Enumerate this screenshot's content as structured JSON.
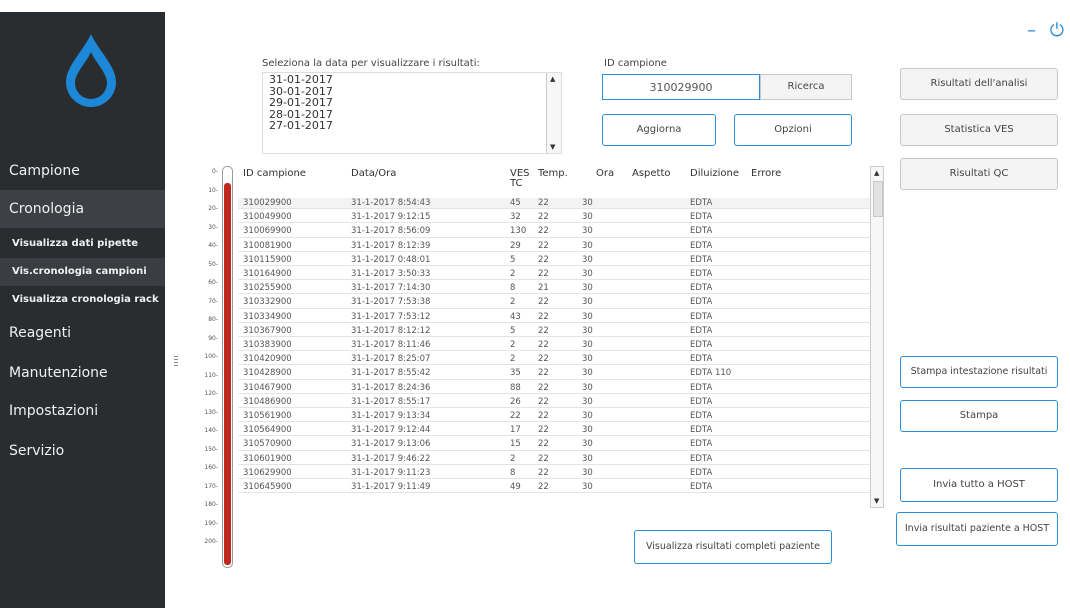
{
  "sidebar": {
    "items": [
      {
        "label": "Campione"
      },
      {
        "label": "Cronologia"
      },
      {
        "label": "Visualizza dati pipette"
      },
      {
        "label": "Vis.cronologia campioni"
      },
      {
        "label": "Visualizza cronologia rack"
      },
      {
        "label": "Reagenti"
      },
      {
        "label": "Manutenzione"
      },
      {
        "label": "Impostazioni"
      },
      {
        "label": "Servizio"
      }
    ]
  },
  "window": {
    "minimize": "–",
    "power": "⏻"
  },
  "date_selector": {
    "label": "Seleziona la data per visualizzare i risultati:",
    "dates": [
      "31-01-2017",
      "30-01-2017",
      "29-01-2017",
      "28-01-2017",
      "27-01-2017"
    ]
  },
  "search": {
    "label": "ID campione",
    "value": "310029900",
    "button": "Ricerca"
  },
  "actions": {
    "aggiorna": "Aggiorna",
    "opzioni": "Opzioni"
  },
  "right_buttons": {
    "risultati_analisi": "Risultati dell'analisi",
    "statistica_ves": "Statistica VES",
    "risultati_qc": "Risultati QC",
    "stampa_intestazione": "Stampa intestazione risultati",
    "stampa": "Stampa",
    "invia_tutto": "Invia tutto a HOST",
    "invia_paziente": "Invia risultati paziente a HOST"
  },
  "bottom_button": "Visualizza risultati completi paziente",
  "thermometer_ticks": [
    "0-",
    "10-",
    "20-",
    "30-",
    "40-",
    "50-",
    "60-",
    "70-",
    "80-",
    "90-",
    "100-",
    "110-",
    "120-",
    "130-",
    "140-",
    "150-",
    "160-",
    "170-",
    "180-",
    "190-",
    "200-"
  ],
  "table": {
    "headers": [
      "ID campione",
      "Data/Ora",
      "VES TC",
      "Temp.",
      "Ora",
      "Aspetto",
      "Diluizione",
      "Errore"
    ],
    "rows": [
      [
        "310029900",
        "31-1-2017 8:54:43",
        "45",
        "22",
        "30",
        "",
        "EDTA",
        ""
      ],
      [
        "310049900",
        "31-1-2017 9:12:15",
        "32",
        "22",
        "30",
        "",
        "EDTA",
        ""
      ],
      [
        "310069900",
        "31-1-2017 8:56:09",
        "130",
        "22",
        "30",
        "",
        "EDTA",
        ""
      ],
      [
        "310081900",
        "31-1-2017 8:12:39",
        "29",
        "22",
        "30",
        "",
        "EDTA",
        ""
      ],
      [
        "310115900",
        "31-1-2017 0:48:01",
        "5",
        "22",
        "30",
        "",
        "EDTA",
        ""
      ],
      [
        "310164900",
        "31-1-2017 3:50:33",
        "2",
        "22",
        "30",
        "",
        "EDTA",
        ""
      ],
      [
        "310255900",
        "31-1-2017 7:14:30",
        "8",
        "21",
        "30",
        "",
        "EDTA",
        ""
      ],
      [
        "310332900",
        "31-1-2017 7:53:38",
        "2",
        "22",
        "30",
        "",
        "EDTA",
        ""
      ],
      [
        "310334900",
        "31-1-2017 7:53:12",
        "43",
        "22",
        "30",
        "",
        "EDTA",
        ""
      ],
      [
        "310367900",
        "31-1-2017 8:12:12",
        "5",
        "22",
        "30",
        "",
        "EDTA",
        ""
      ],
      [
        "310383900",
        "31-1-2017 8:11:46",
        "2",
        "22",
        "30",
        "",
        "EDTA",
        ""
      ],
      [
        "310420900",
        "31-1-2017 8:25:07",
        "2",
        "22",
        "30",
        "",
        "EDTA",
        ""
      ],
      [
        "310428900",
        "31-1-2017 8:55:42",
        "35",
        "22",
        "30",
        "",
        "EDTA 110",
        ""
      ],
      [
        "310467900",
        "31-1-2017 8:24:36",
        "88",
        "22",
        "30",
        "",
        "EDTA",
        ""
      ],
      [
        "310486900",
        "31-1-2017 8:55:17",
        "26",
        "22",
        "30",
        "",
        "EDTA",
        ""
      ],
      [
        "310561900",
        "31-1-2017 9:13:34",
        "22",
        "22",
        "30",
        "",
        "EDTA",
        ""
      ],
      [
        "310564900",
        "31-1-2017 9:12:44",
        "17",
        "22",
        "30",
        "",
        "EDTA",
        ""
      ],
      [
        "310570900",
        "31-1-2017 9:13:06",
        "15",
        "22",
        "30",
        "",
        "EDTA",
        ""
      ],
      [
        "310601900",
        "31-1-2017 9:46:22",
        "2",
        "22",
        "30",
        "",
        "EDTA",
        ""
      ],
      [
        "310629900",
        "31-1-2017 9:11:23",
        "8",
        "22",
        "30",
        "",
        "EDTA",
        ""
      ],
      [
        "310645900",
        "31-1-2017 9:11:49",
        "49",
        "22",
        "30",
        "",
        "EDTA",
        ""
      ]
    ]
  },
  "colors": {
    "accent": "#2a8fd8",
    "sidebar": "#2a2d30",
    "thermometer": "#c0281e"
  }
}
